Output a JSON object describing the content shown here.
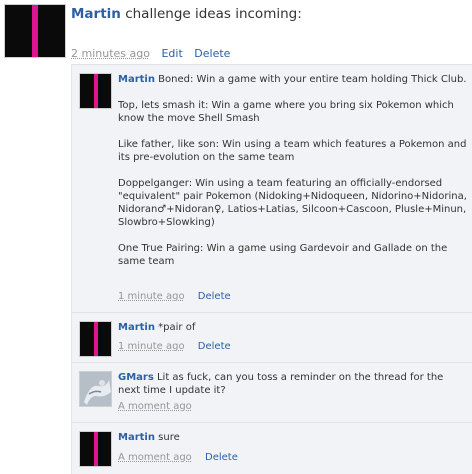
{
  "post": {
    "author": "Martin",
    "text": "challenge ideas incoming:",
    "time": "2 minutes ago",
    "edit": "Edit",
    "delete": "Delete"
  },
  "comments": [
    {
      "author": "Martin",
      "paragraphs": [
        "Boned: Win a game with your entire team holding Thick Club.",
        "Top, lets smash it: Win a game where you bring six Pokemon which know the move Shell Smash",
        "Like father, like son: Win using a team which features a Pokemon and its pre-evolution on the same team",
        "Doppelganger: Win using a team featuring an officially-endorsed \"equivalent\" pair Pokemon (Nidoking+Nidoqueen, Nidorino+Nidorina, Nidoran♂+Nidoran♀, Latios+Latias, Silcoon+Cascoon, Plusle+Minun, Slowbro+Slowking)",
        "One True Pairing: Win a game using Gardevoir and Gallade on the same team"
      ],
      "time": "1 minute ago",
      "delete": "Delete"
    },
    {
      "author": "Martin",
      "paragraphs": [
        "*pair of"
      ],
      "time": "1 minute ago",
      "delete": "Delete"
    },
    {
      "author": "GMars",
      "paragraphs": [
        "Lit as fuck, can you toss a reminder on the thread for the next time I update it?"
      ],
      "time": "A moment ago"
    },
    {
      "author": "Martin",
      "paragraphs": [
        "sure"
      ],
      "time": "A moment ago",
      "delete": "Delete"
    }
  ],
  "colors": {
    "author": "#2d5fa5",
    "avatar_bg": "#0a0a0a",
    "avatar_stripe": "#e0148c",
    "comments_bg": "#f1f3f6",
    "meta_gray": "#969696"
  }
}
